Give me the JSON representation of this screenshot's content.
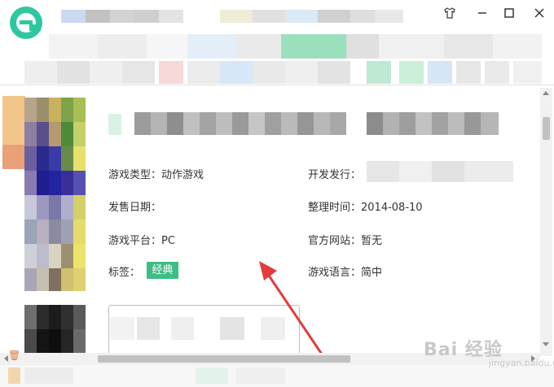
{
  "window": {
    "logo_icon": "e-browser-logo-icon",
    "controls": {
      "skin_icon": "tshirt-icon",
      "minimize_icon": "minimize-icon",
      "maximize_icon": "maximize-icon",
      "close_icon": "close-icon"
    }
  },
  "game_info": {
    "type_label": "游戏类型：",
    "type_value": "动作游戏",
    "release_label": "发售日期：",
    "release_value": "",
    "platform_label": "游戏平台：",
    "platform_value": "PC",
    "tags_label": "标签：",
    "tags": [
      "经典"
    ],
    "developer_label": "开发发行：",
    "updated_label": "整理时间：",
    "updated_value": "2014-08-10",
    "website_label": "官方网站：",
    "website_value": "暂无",
    "language_label": "游戏语言：",
    "language_value": "简中"
  },
  "watermark": {
    "text": "Bai 经验",
    "sub": "jingyan.baidu.com"
  },
  "colors": {
    "accent_green": "#3fbd84",
    "arrow_red": "#e23b3b",
    "scrollbar": "#f1f1f1"
  }
}
